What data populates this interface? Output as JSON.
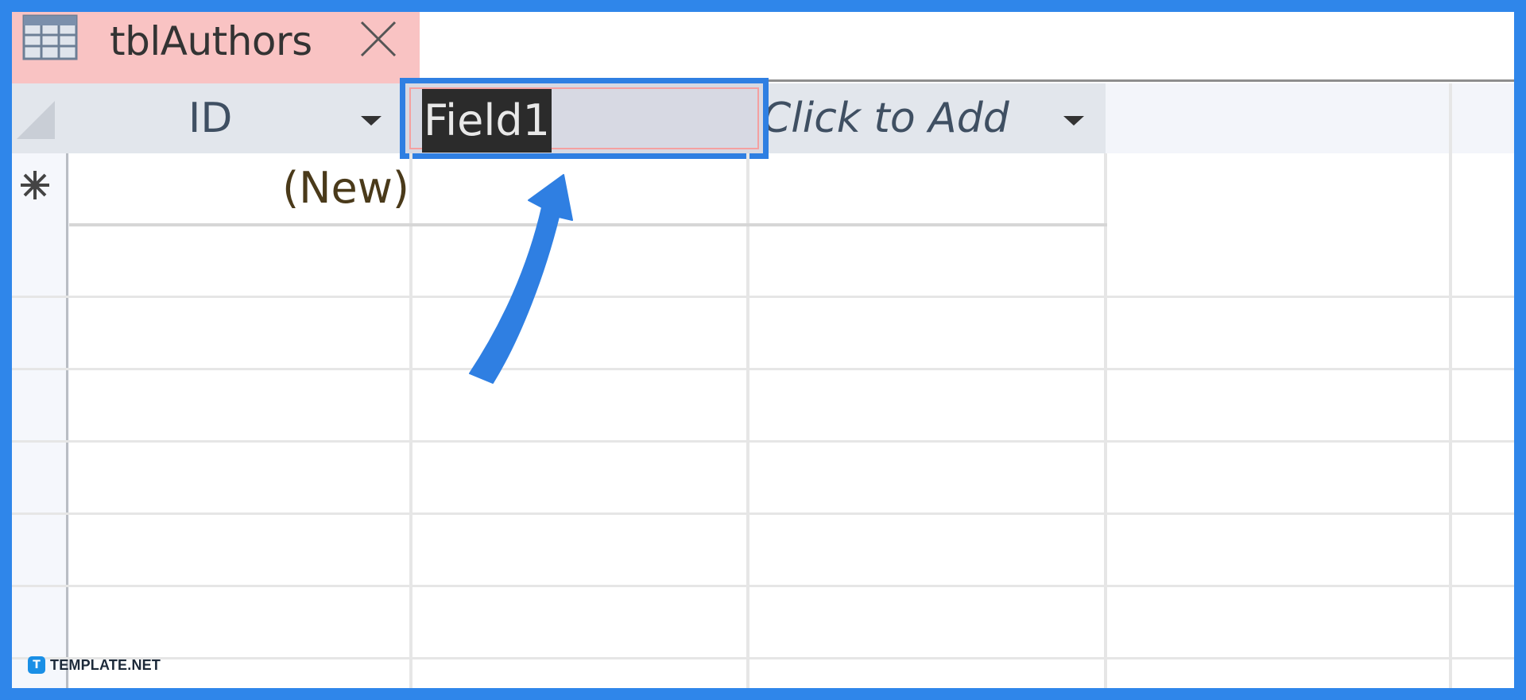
{
  "tab": {
    "title": "tblAuthors",
    "icon": "table-icon",
    "close_icon": "close-icon"
  },
  "columns": [
    {
      "label": "ID",
      "has_dropdown": true
    },
    {
      "label": "Field1",
      "selected": true
    },
    {
      "label": "Click to Add",
      "has_dropdown": true
    }
  ],
  "new_row": {
    "marker_icon": "new-record-icon",
    "id_value": "(New)"
  },
  "annotation": {
    "icon": "pointer-arrow-icon",
    "color": "#2f7fe2"
  },
  "colors": {
    "frame": "#2f86ea",
    "tab": "#f9c3c3",
    "header": "#e2e6ec",
    "selection_outline": "#2f7fe2"
  },
  "branding": {
    "logo_letter": "T",
    "name": "TEMPLATE.NET"
  }
}
